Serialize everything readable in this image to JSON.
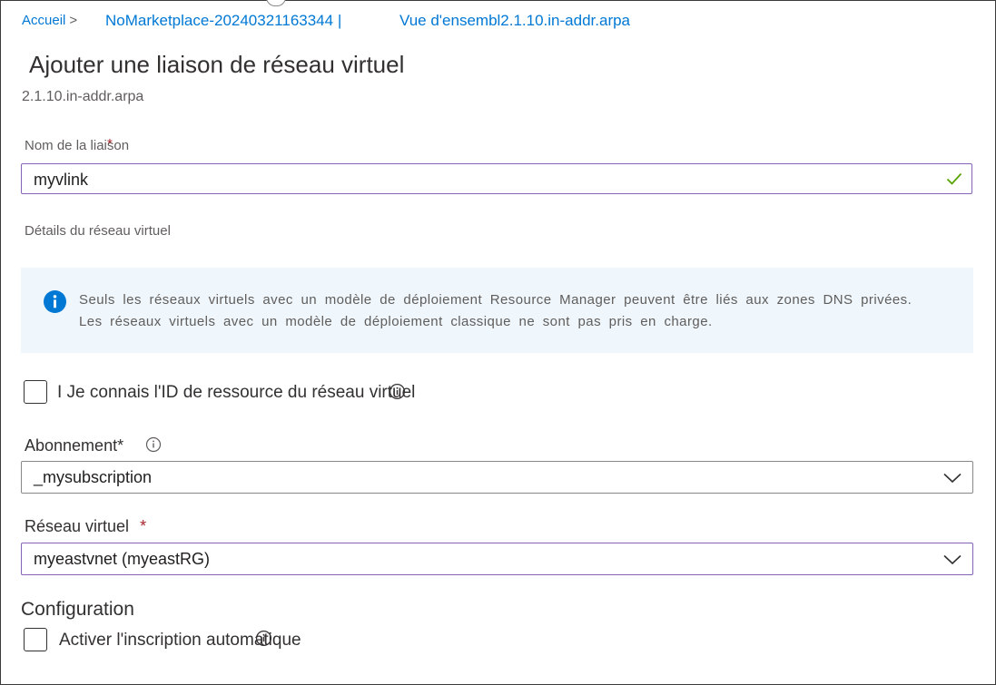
{
  "breadcrumb": {
    "home": "Accueil",
    "separator": ">",
    "resource": "NoMarketplace-20240321163344 |",
    "overview": "Vue d'ensembl",
    "zone": "2.1.10.in-addr.arpa"
  },
  "page": {
    "title": "Ajouter une liaison de réseau virtuel",
    "subtitle": "2.1.10.in-addr.arpa"
  },
  "link_name": {
    "label": "Nom de la liaison",
    "required_mark": "*",
    "value": "myvlink"
  },
  "vnet_details": {
    "label": "Détails du réseau virtuel"
  },
  "info": {
    "line1": "Seuls les réseaux virtuels avec un modèle de déploiement Resource Manager peuvent être liés aux zones DNS privées.",
    "line2": "Les réseaux virtuels avec un modèle de déploiement classique ne sont pas pris en charge."
  },
  "know_id": {
    "label": "I Je connais l'ID de ressource du réseau virtuel",
    "checked": false
  },
  "subscription": {
    "label": "Abonnement*",
    "value": "_mysubscription"
  },
  "vnet": {
    "label": "Réseau virtuel",
    "required_mark": "*",
    "value": "myeastvnet (myeastRG)"
  },
  "configuration": {
    "heading": "Configuration",
    "auto_reg_label": "Activer l'inscription automatique",
    "checked": false
  },
  "colors": {
    "accent": "#0078d4",
    "focus_border": "#8764b8",
    "required": "#a4262c",
    "success": "#57a300",
    "info_bg": "#eff6fc"
  },
  "icons": [
    "info-filled-icon",
    "info-circle-icon",
    "checkmark-icon",
    "chevron-down-icon"
  ]
}
